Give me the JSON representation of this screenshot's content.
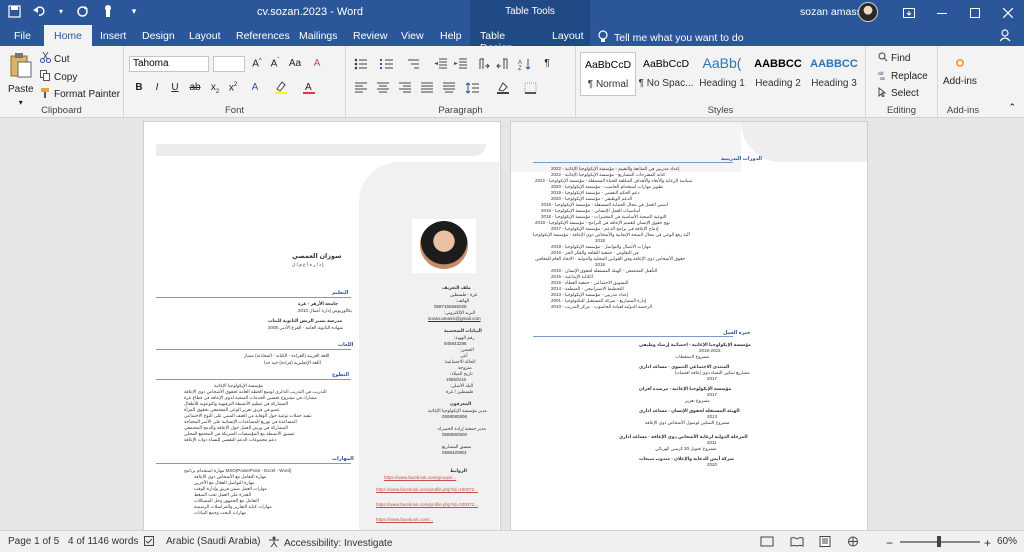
{
  "titlebar": {
    "doc_title": "cv.sozan.2023  -  Word",
    "context_label": "Table Tools",
    "user_name": "sozan amassi"
  },
  "tabs": [
    "File",
    "Home",
    "Insert",
    "Design",
    "Layout",
    "References",
    "Mailings",
    "Review",
    "View",
    "Help",
    "Table Design",
    "Layout"
  ],
  "tell_me": "Tell me what you want to do",
  "clipboard": {
    "paste": "Paste",
    "cut": "Cut",
    "copy": "Copy",
    "format_painter": "Format Painter",
    "label": "Clipboard"
  },
  "font": {
    "name": "Tahoma",
    "size": "",
    "label": "Font"
  },
  "paragraph": {
    "label": "Paragraph"
  },
  "styles": {
    "label": "Styles",
    "items": [
      {
        "sample": "AaBbCcD",
        "name": "¶ Normal"
      },
      {
        "sample": "AaBbCcD",
        "name": "¶ No Spac..."
      },
      {
        "sample": "AaBb(",
        "name": "Heading 1"
      },
      {
        "sample": "AABBCC",
        "name": "Heading 2"
      },
      {
        "sample": "AABBCC",
        "name": "Heading 3"
      }
    ]
  },
  "editing": {
    "find": "Find",
    "replace": "Replace",
    "select": "Select",
    "label": "Editing"
  },
  "addins": {
    "button": "Add-ins",
    "label": "Add-ins"
  },
  "doc": {
    "name": "سوزان العمصي",
    "email": "sozan.amassi@gmail.com",
    "phone": "0597155665028",
    "link1": "https://www.facebook.com/groups/...",
    "link2": "https://www.facebook.com/profile.php?id=100072...",
    "link3": "https://www.facebook.com/profile.php?id=100072...",
    "year_a": "2010",
    "year_b": "2015",
    "year_c": "2017",
    "year_d": "2011",
    "year_e": "2020"
  },
  "status": {
    "page": "Page 1 of 5",
    "words": "4 of 1146 words",
    "language": "Arabic (Saudi Arabia)",
    "accessibility": "Accessibility: Investigate",
    "zoom": "60%"
  }
}
